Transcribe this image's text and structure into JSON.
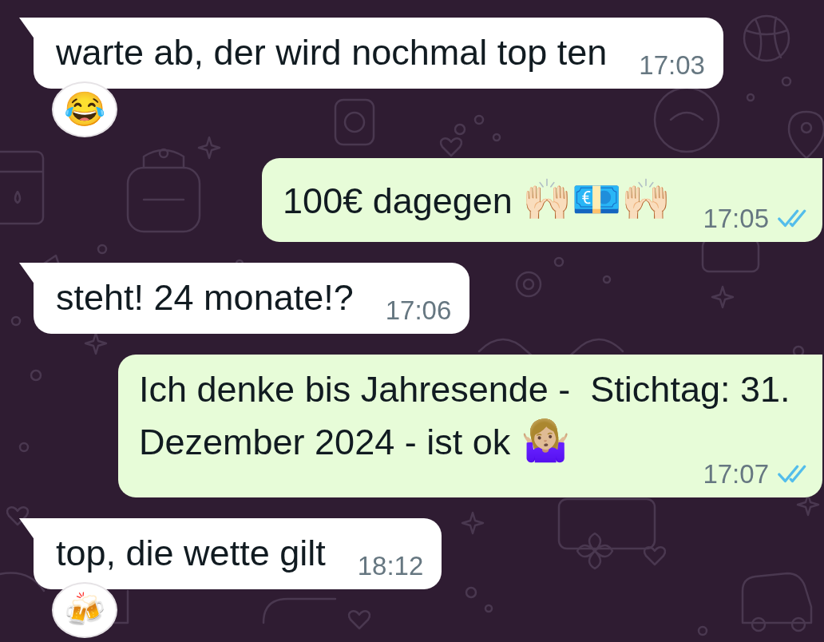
{
  "messages": [
    {
      "kind": "incoming",
      "text": "warte ab, der wird nochmal top ten",
      "time": "17:03",
      "reaction": "😂"
    },
    {
      "kind": "outgoing",
      "text": "100€ dagegen 🙌🏻💶🙌🏻",
      "time": "17:05",
      "read": true
    },
    {
      "kind": "incoming",
      "text": "steht! 24 monate!?",
      "time": "17:06"
    },
    {
      "kind": "outgoing",
      "text": "Ich denke bis Jahresende -  Stichtag: 31. Dezember 2024 - ist ok 🤷🏼‍♀️",
      "time": "17:07",
      "read": true
    },
    {
      "kind": "incoming",
      "text": "top, die wette gilt",
      "time": "18:12",
      "reaction": "🍻"
    }
  ]
}
